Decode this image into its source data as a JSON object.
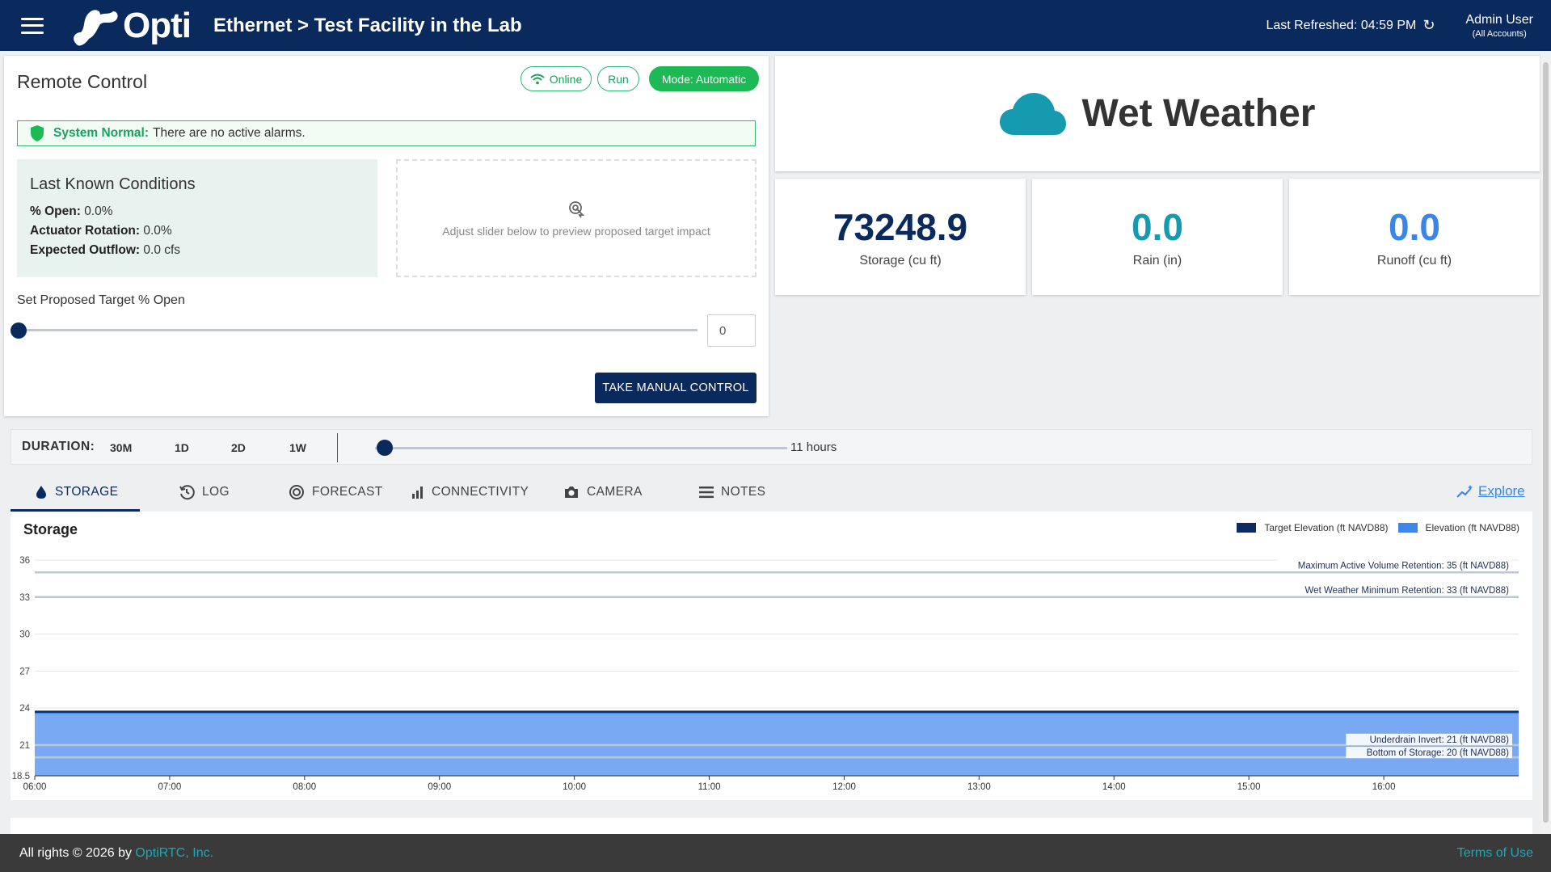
{
  "header": {
    "brand": "Opti",
    "breadcrumb": "Ethernet > Test Facility in the Lab",
    "last_refreshed": "Last Refreshed: 04:59 PM",
    "user_name": "Admin User",
    "user_scope": "(All Accounts)"
  },
  "remote": {
    "title": "Remote Control",
    "online": "Online",
    "run": "Run",
    "mode": "Mode: Automatic",
    "alarm_title": "System Normal:",
    "alarm_text": "There are no active alarms.",
    "lkc_title": "Last Known Conditions",
    "open_label": "% Open:",
    "open_value": "0.0%",
    "rotation_label": "Actuator Rotation:",
    "rotation_value": "0.0%",
    "outflow_label": "Expected Outflow:",
    "outflow_value": "0.0 cfs",
    "preview_text": "Adjust slider below to preview proposed target impact",
    "set_label": "Set Proposed Target % Open",
    "target_value": "0",
    "manual_button": "TAKE MANUAL CONTROL"
  },
  "weather": {
    "label": "Wet Weather"
  },
  "stats": [
    {
      "value": "73248.9",
      "label": "Storage (cu ft)"
    },
    {
      "value": "0.0",
      "label": "Rain (in)"
    },
    {
      "value": "0.0",
      "label": "Runoff (cu ft)"
    }
  ],
  "duration": {
    "label": "DURATION:",
    "options": [
      "30M",
      "1D",
      "2D",
      "1W"
    ],
    "hours": "11 hours"
  },
  "tabs": [
    "STORAGE",
    "LOG",
    "FORECAST",
    "CONNECTIVITY",
    "CAMERA",
    "NOTES"
  ],
  "explore": "Explore",
  "chart_data": {
    "type": "area",
    "title": "Storage",
    "legend": [
      "Target Elevation (ft NAVD88)",
      "Elevation (ft NAVD88)"
    ],
    "legend_position": "top-right",
    "colors": {
      "target": "#0d2a63",
      "elevation": "#3f86ea",
      "elevation_fill": "#7aa9f3",
      "threshold": "#b8c8dc"
    },
    "x_ticks": [
      "06:00",
      "07:00",
      "08:00",
      "09:00",
      "10:00",
      "11:00",
      "12:00",
      "13:00",
      "14:00",
      "15:00",
      "16:00"
    ],
    "y_ticks": [
      "36",
      "33",
      "30",
      "27",
      "24",
      "21",
      "18.5"
    ],
    "ylim": [
      18.5,
      36
    ],
    "x_range_hours": [
      6,
      17
    ],
    "series": [
      {
        "name": "Target Elevation (ft NAVD88)",
        "values": [
          23.7,
          23.7
        ]
      },
      {
        "name": "Elevation (ft NAVD88)",
        "values": [
          23.6,
          23.6
        ]
      }
    ],
    "thresholds": [
      {
        "label": "Maximum Active Volume Retention: 35 (ft NAVD88)",
        "value": 35
      },
      {
        "label": "Wet Weather Minimum Retention: 33 (ft NAVD88)",
        "value": 33
      },
      {
        "label": "Underdrain Invert: 21 (ft NAVD88)",
        "value": 21
      },
      {
        "label": "Bottom of Storage: 20 (ft NAVD88)",
        "value": 20
      }
    ],
    "grid": true
  },
  "footer": {
    "copyright": "All rights © 2026 by",
    "company": "OptiRTC, Inc.",
    "terms": "Terms of Use"
  }
}
